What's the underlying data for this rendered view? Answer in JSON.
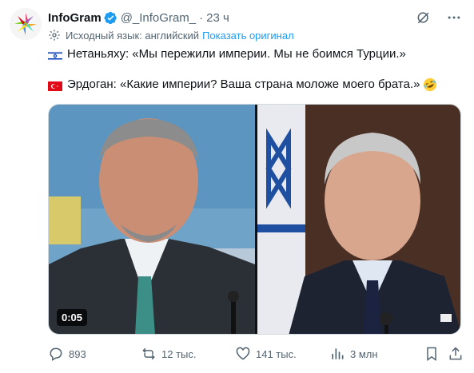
{
  "tweet": {
    "author_name": "InfoGram",
    "handle": "@_InfoGram_",
    "separator": "·",
    "time": "23 ч",
    "translation": {
      "label": "Исходный язык: английский",
      "show_original": "Показать оригинал"
    },
    "line1": "Нетаньяху: «Мы пережили империи. Мы не боимся Турции.»",
    "line2": "Эрдоган: «Какие империи? Ваша страна моложе моего брата.»",
    "media": {
      "duration": "0:05"
    },
    "stats": {
      "replies": "893",
      "retweets": "12 тыс.",
      "likes": "141 тыс.",
      "views": "3 млн"
    }
  },
  "icons": {
    "verified": "verified-badge-icon",
    "grok": "grok-icon",
    "more": "more-icon",
    "translate": "translate-gear-icon",
    "flag_israel": "israel-flag-icon",
    "flag_turkey": "turkey-flag-icon",
    "emoji": "rofl-emoji-icon",
    "reply": "reply-icon",
    "retweet": "retweet-icon",
    "like": "heart-icon",
    "views": "views-icon",
    "bookmark": "bookmark-icon",
    "share": "share-icon"
  },
  "colors": {
    "accent": "#1d9bf0",
    "text": "#0f1419",
    "secondary": "#536471"
  }
}
